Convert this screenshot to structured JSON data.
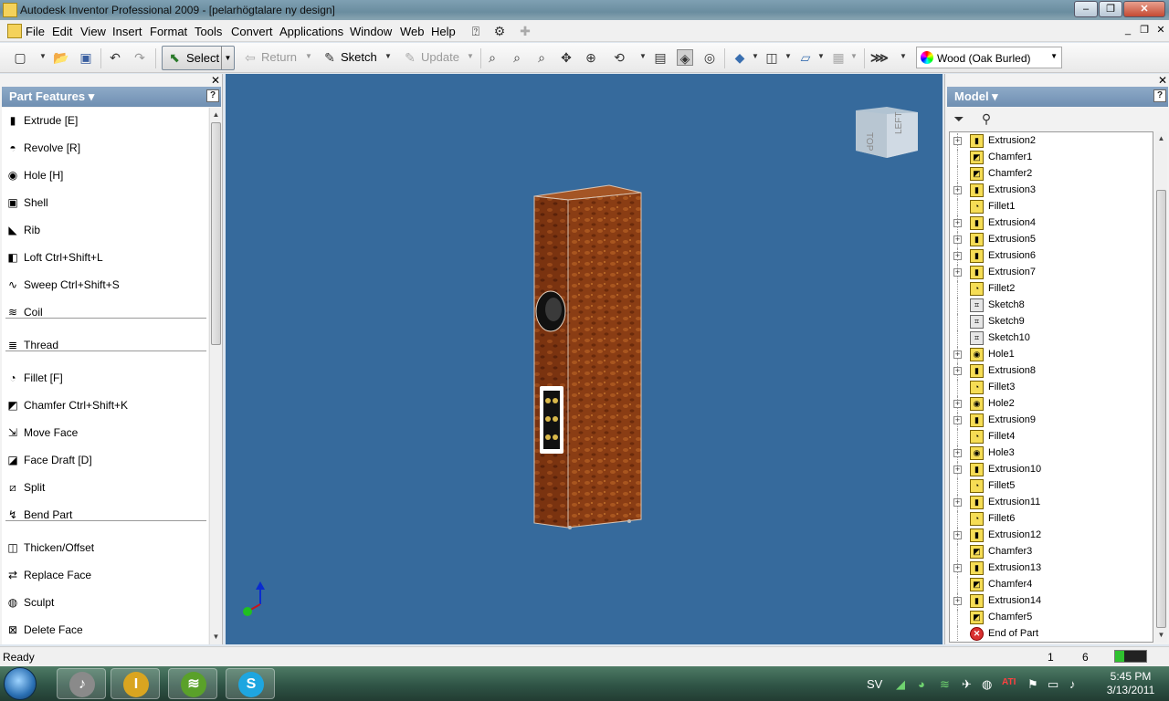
{
  "window": {
    "title": "Autodesk Inventor Professional 2009 - [pelarhögtalare ny design]"
  },
  "menu": [
    "File",
    "Edit",
    "View",
    "Insert",
    "Format",
    "Tools",
    "Convert",
    "Applications",
    "Window",
    "Web",
    "Help"
  ],
  "toolbar": {
    "select_label": "Select",
    "return_label": "Return",
    "sketch_label": "Sketch",
    "update_label": "Update",
    "material": "Wood (Oak Burled)"
  },
  "left_panel": {
    "title": "Part Features",
    "features": [
      {
        "label": "Extrude   [E]",
        "icon": "extrude-icon",
        "glyph": "▮"
      },
      {
        "label": "Revolve   [R]",
        "icon": "revolve-icon",
        "glyph": "◓"
      },
      {
        "label": "Hole   [H]",
        "icon": "hole-icon",
        "glyph": "◉"
      },
      {
        "label": "Shell",
        "icon": "shell-icon",
        "glyph": "▣"
      },
      {
        "label": "Rib",
        "icon": "rib-icon",
        "glyph": "◣"
      },
      {
        "label": "Loft    Ctrl+Shift+L",
        "icon": "loft-icon",
        "glyph": "◧"
      },
      {
        "label": "Sweep    Ctrl+Shift+S",
        "icon": "sweep-icon",
        "glyph": "∿"
      },
      {
        "label": "Coil",
        "icon": "coil-icon",
        "glyph": "≋"
      },
      {
        "label": "Thread",
        "icon": "thread-icon",
        "glyph": "≣"
      },
      {
        "label": "Fillet    [F]",
        "icon": "fillet-icon",
        "glyph": "◔"
      },
      {
        "label": "Chamfer    Ctrl+Shift+K",
        "icon": "chamfer-icon",
        "glyph": "◩"
      },
      {
        "label": "Move Face",
        "icon": "move-face-icon",
        "glyph": "⇲"
      },
      {
        "label": "Face Draft    [D]",
        "icon": "face-draft-icon",
        "glyph": "◪"
      },
      {
        "label": "Split",
        "icon": "split-icon",
        "glyph": "⧄"
      },
      {
        "label": "Bend Part",
        "icon": "bend-part-icon",
        "glyph": "↯"
      },
      {
        "label": "Thicken/Offset",
        "icon": "thicken-icon",
        "glyph": "◫"
      },
      {
        "label": "Replace Face",
        "icon": "replace-face-icon",
        "glyph": "⇄"
      },
      {
        "label": "Sculpt",
        "icon": "sculpt-icon",
        "glyph": "◍"
      },
      {
        "label": "Delete Face",
        "icon": "delete-face-icon",
        "glyph": "⊠"
      }
    ]
  },
  "viewcube": {
    "top_label": "TOP",
    "left_label": "LEFT"
  },
  "right_panel": {
    "title": "Model",
    "tree": [
      {
        "label": "Extrusion2",
        "kind": "extrusion",
        "expandable": true
      },
      {
        "label": "Chamfer1",
        "kind": "chamfer",
        "expandable": false
      },
      {
        "label": "Chamfer2",
        "kind": "chamfer",
        "expandable": false
      },
      {
        "label": "Extrusion3",
        "kind": "extrusion",
        "expandable": true
      },
      {
        "label": "Fillet1",
        "kind": "fillet",
        "expandable": false
      },
      {
        "label": "Extrusion4",
        "kind": "extrusion",
        "expandable": true
      },
      {
        "label": "Extrusion5",
        "kind": "extrusion",
        "expandable": true
      },
      {
        "label": "Extrusion6",
        "kind": "extrusion",
        "expandable": true
      },
      {
        "label": "Extrusion7",
        "kind": "extrusion",
        "expandable": true
      },
      {
        "label": "Fillet2",
        "kind": "fillet",
        "expandable": false
      },
      {
        "label": "Sketch8",
        "kind": "sketch",
        "expandable": false
      },
      {
        "label": "Sketch9",
        "kind": "sketch",
        "expandable": false
      },
      {
        "label": "Sketch10",
        "kind": "sketch",
        "expandable": false
      },
      {
        "label": "Hole1",
        "kind": "hole",
        "expandable": true
      },
      {
        "label": "Extrusion8",
        "kind": "extrusion",
        "expandable": true
      },
      {
        "label": "Fillet3",
        "kind": "fillet",
        "expandable": false
      },
      {
        "label": "Hole2",
        "kind": "hole",
        "expandable": true
      },
      {
        "label": "Extrusion9",
        "kind": "extrusion",
        "expandable": true
      },
      {
        "label": "Fillet4",
        "kind": "fillet",
        "expandable": false
      },
      {
        "label": "Hole3",
        "kind": "hole",
        "expandable": true
      },
      {
        "label": "Extrusion10",
        "kind": "extrusion",
        "expandable": true
      },
      {
        "label": "Fillet5",
        "kind": "fillet",
        "expandable": false
      },
      {
        "label": "Extrusion11",
        "kind": "extrusion",
        "expandable": true
      },
      {
        "label": "Fillet6",
        "kind": "fillet",
        "expandable": false
      },
      {
        "label": "Extrusion12",
        "kind": "extrusion",
        "expandable": true
      },
      {
        "label": "Chamfer3",
        "kind": "chamfer",
        "expandable": false
      },
      {
        "label": "Extrusion13",
        "kind": "extrusion",
        "expandable": true
      },
      {
        "label": "Chamfer4",
        "kind": "chamfer",
        "expandable": false
      },
      {
        "label": "Extrusion14",
        "kind": "extrusion",
        "expandable": true
      },
      {
        "label": "Chamfer5",
        "kind": "chamfer",
        "expandable": false
      },
      {
        "label": "End of Part",
        "kind": "end",
        "expandable": false
      }
    ]
  },
  "status": {
    "text": "Ready",
    "count1": "1",
    "count2": "6",
    "meter_fraction": 0.3
  },
  "taskbar": {
    "apps": [
      {
        "name": "itunes-task",
        "icon": "itunes-icon",
        "glyph": "♪",
        "color": "#8a8a8a"
      },
      {
        "name": "inventor-task",
        "icon": "inventor-icon",
        "glyph": "I",
        "color": "#d9a520"
      },
      {
        "name": "spotify-task",
        "icon": "spotify-icon",
        "glyph": "≋",
        "color": "#5aa12a"
      },
      {
        "name": "skype-task",
        "icon": "skype-icon",
        "glyph": "S",
        "color": "#1ea6e0"
      }
    ],
    "language": "SV",
    "time": "5:45 PM",
    "date": "3/13/2011"
  },
  "colors": {
    "viewport": "#366a9c",
    "panel_header": "#7e9dbf",
    "wood": "#8a3d14"
  }
}
